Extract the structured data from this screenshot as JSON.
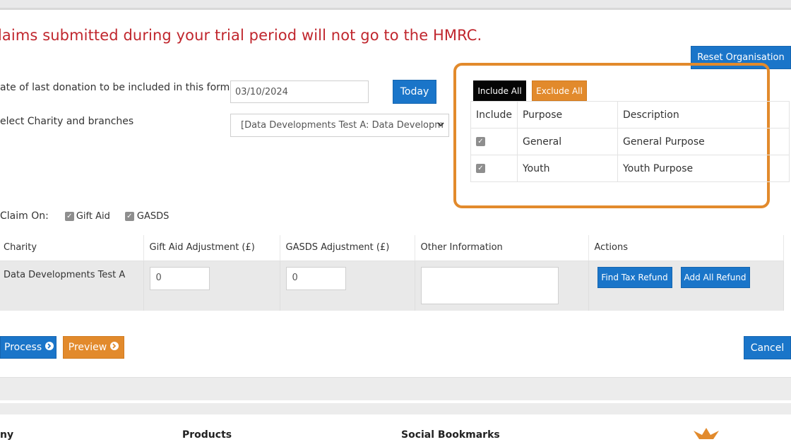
{
  "warning_text": "laims submitted during your trial period will not go to the HMRC.",
  "buttons": {
    "reset_org": "Reset Organisation",
    "today": "Today",
    "include_all": "Include All",
    "exclude_all": "Exclude All",
    "process": "Process",
    "preview": "Preview",
    "cancel": "Cancel",
    "find_tax_refund": "Find Tax Refund",
    "add_all_refund": "Add All Refund"
  },
  "form": {
    "last_donation_label": "ate of last donation to be included in this form",
    "last_donation_value": "03/10/2024",
    "charity_label": "elect Charity and branches",
    "charity_selected": "[Data Developments Test A: Data Developm"
  },
  "purposes": {
    "headers": [
      "Include",
      "Purpose",
      "Description"
    ],
    "rows": [
      {
        "purpose": "General",
        "description": "General Purpose",
        "checked": true
      },
      {
        "purpose": "Youth",
        "description": "Youth Purpose",
        "checked": true
      }
    ]
  },
  "claim_on": {
    "label": "Claim On:",
    "options": [
      {
        "label": "Gift Aid",
        "checked": true
      },
      {
        "label": "GASDS",
        "checked": true
      }
    ]
  },
  "claims_table": {
    "headers": [
      "Charity",
      "Gift Aid Adjustment (£)",
      "GASDS Adjustment (£)",
      "Other Information",
      "Actions"
    ],
    "row": {
      "charity": "Data Developments Test A",
      "gift_aid_adjustment": "0",
      "gasds_adjustment": "0"
    }
  },
  "footer": {
    "col1": "ny",
    "col2": "Products",
    "col3": "Social Bookmarks"
  },
  "colors": {
    "accent_blue": "#1a75c9",
    "accent_orange": "#e28a2c",
    "warning_red": "#c0262d"
  }
}
